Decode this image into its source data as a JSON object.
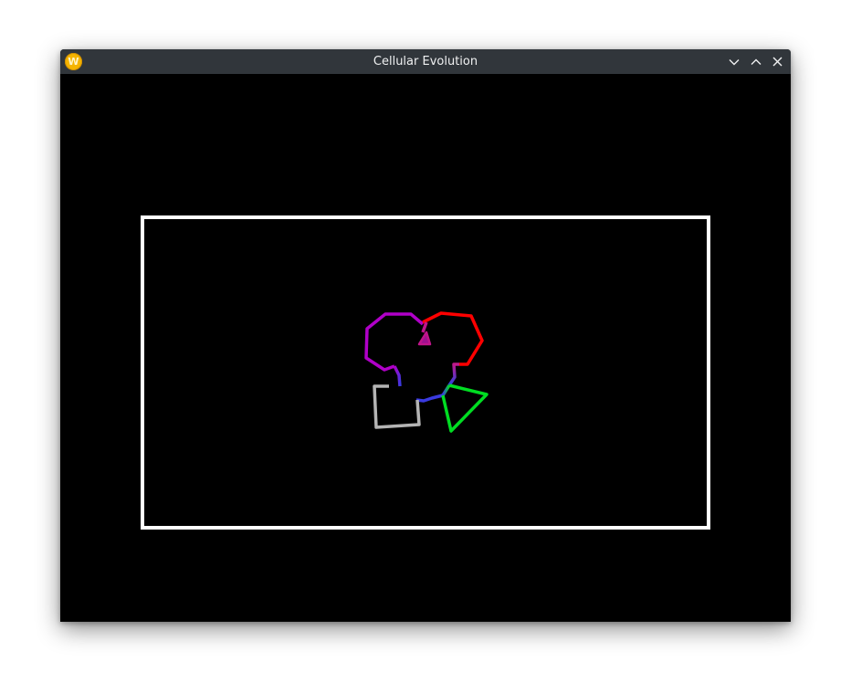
{
  "window": {
    "title": "Cellular Evolution",
    "app_icon_letter": "W",
    "app_icon_name": "app-logo-icon",
    "controls": {
      "minimize_icon": "chevron-down-icon",
      "maximize_icon": "chevron-up-icon",
      "close_icon": "close-icon"
    }
  },
  "scene": {
    "background_color": "#000000",
    "arena_border_color": "#ffffff",
    "organism_colors": {
      "purple_cell": "#b000c8",
      "red_cell": "#ff0000",
      "green_cell": "#00dd22",
      "gray_cell": "#b4b4b4",
      "blue_core": "#3a3ae0"
    }
  }
}
